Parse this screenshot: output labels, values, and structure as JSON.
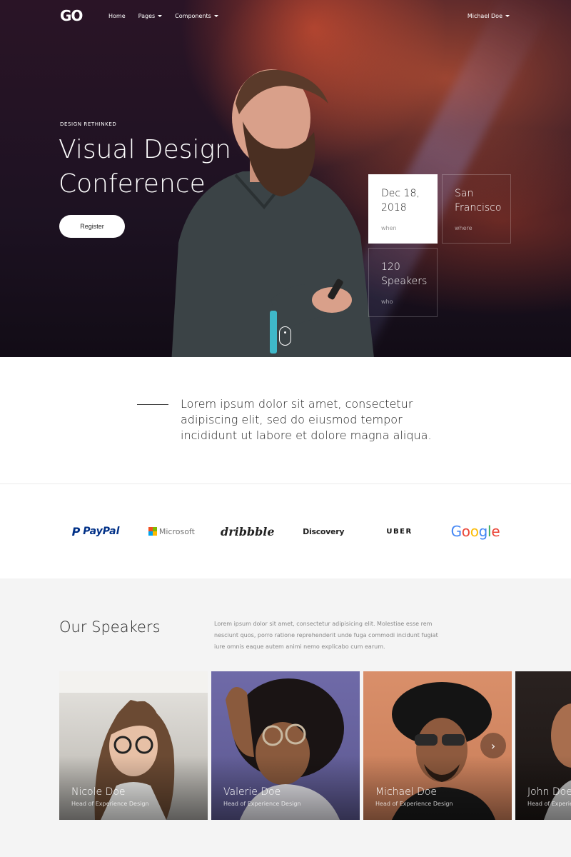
{
  "nav": {
    "logo": "GO",
    "links": [
      {
        "label": "Home",
        "dropdown": false
      },
      {
        "label": "Pages",
        "dropdown": true
      },
      {
        "label": "Components",
        "dropdown": true
      }
    ],
    "user": "Michael Doe"
  },
  "hero": {
    "eyebrow": "DESIGN RETHINKED",
    "title_line1": "Visual Design",
    "title_line2": "Conference",
    "register_label": "Register",
    "cards": [
      {
        "value_line1": "Dec 18,",
        "value_line2": "2018",
        "label": "when"
      },
      {
        "value_line1": "San",
        "value_line2": "Francisco",
        "label": "where"
      },
      {
        "value_line1": "120",
        "value_line2": "Speakers",
        "label": "who"
      }
    ]
  },
  "quote": {
    "line1": "Lorem ipsum dolor sit amet, consectetur",
    "line2": "adipiscing elit, sed do eiusmod tempor",
    "line3": "incididunt ut labore et dolore magna aliqua."
  },
  "brands": {
    "paypal": "PayPal",
    "microsoft": "Microsoft",
    "dribbble": "dribbble",
    "discovery": "Discovery",
    "uber": "UBER",
    "google": "Google"
  },
  "speakers": {
    "title": "Our Speakers",
    "description": "Lorem ipsum dolor sit amet, consectetur adipisicing elit. Molestiae esse rem nesciunt quos, porro ratione reprehenderit unde fuga commodi incidunt fugiat iure omnis eaque autem animi nemo explicabo cum earum.",
    "items": [
      {
        "name": "Nicole Doe",
        "role": "Head of Experience Design"
      },
      {
        "name": "Valerie Doe",
        "role": "Head of Experience Design"
      },
      {
        "name": "Michael Doe",
        "role": "Head of Experience Design"
      },
      {
        "name": "John Doe",
        "role": "Head of Experience Design"
      }
    ],
    "next_icon": "chevron-right-icon"
  }
}
